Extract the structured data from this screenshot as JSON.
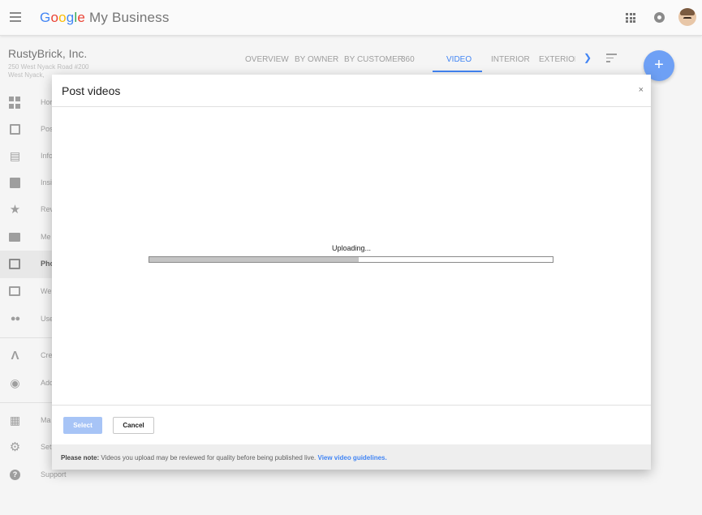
{
  "header": {
    "logo_letters": [
      "G",
      "o",
      "o",
      "g",
      "l",
      "e"
    ],
    "product": "My Business"
  },
  "business": {
    "name": "RustyBrick, Inc.",
    "address_line1": "250 West Nyack Road #200",
    "address_line2": "West Nyack,"
  },
  "tabs": [
    {
      "label": "OVERVIEW"
    },
    {
      "label": "BY OWNER"
    },
    {
      "label": "BY CUSTOMER"
    },
    {
      "label": "360"
    },
    {
      "label": "VIDEO",
      "active": true
    },
    {
      "label": "INTERIOR"
    },
    {
      "label": "EXTERIOF"
    }
  ],
  "sidebar": {
    "items": [
      {
        "label": "Hor",
        "icon": "dashboard-icon"
      },
      {
        "label": "Pos",
        "icon": "posts-icon"
      },
      {
        "label": "Info",
        "icon": "store-icon"
      },
      {
        "label": "Insi",
        "icon": "insights-icon"
      },
      {
        "label": "Rev",
        "icon": "star-icon"
      },
      {
        "label": "Me",
        "icon": "message-icon"
      },
      {
        "label": "Pho",
        "icon": "photos-icon",
        "active": true
      },
      {
        "label": "We",
        "icon": "website-icon"
      },
      {
        "label": "Use",
        "icon": "users-icon"
      },
      {
        "label": "Cre",
        "icon": "ads-icon"
      },
      {
        "label": "Add",
        "icon": "add-location-icon"
      },
      {
        "label": "Ma",
        "icon": "manage-locations-icon"
      },
      {
        "label": "Set",
        "icon": "gear-icon"
      },
      {
        "label": "Support",
        "icon": "help-icon"
      }
    ]
  },
  "modal": {
    "title": "Post videos",
    "close": "×",
    "status": "Uploading...",
    "progress": 0.52,
    "select_label": "Select",
    "cancel_label": "Cancel",
    "note_prefix": "Please note:",
    "note_text": " Videos you upload may be reviewed for quality before being published live. ",
    "note_link": "View video guidelines."
  },
  "colors": {
    "accent": "#4285f4",
    "fab": "#6ea0f5",
    "select_disabled": "#a7c4f6"
  }
}
